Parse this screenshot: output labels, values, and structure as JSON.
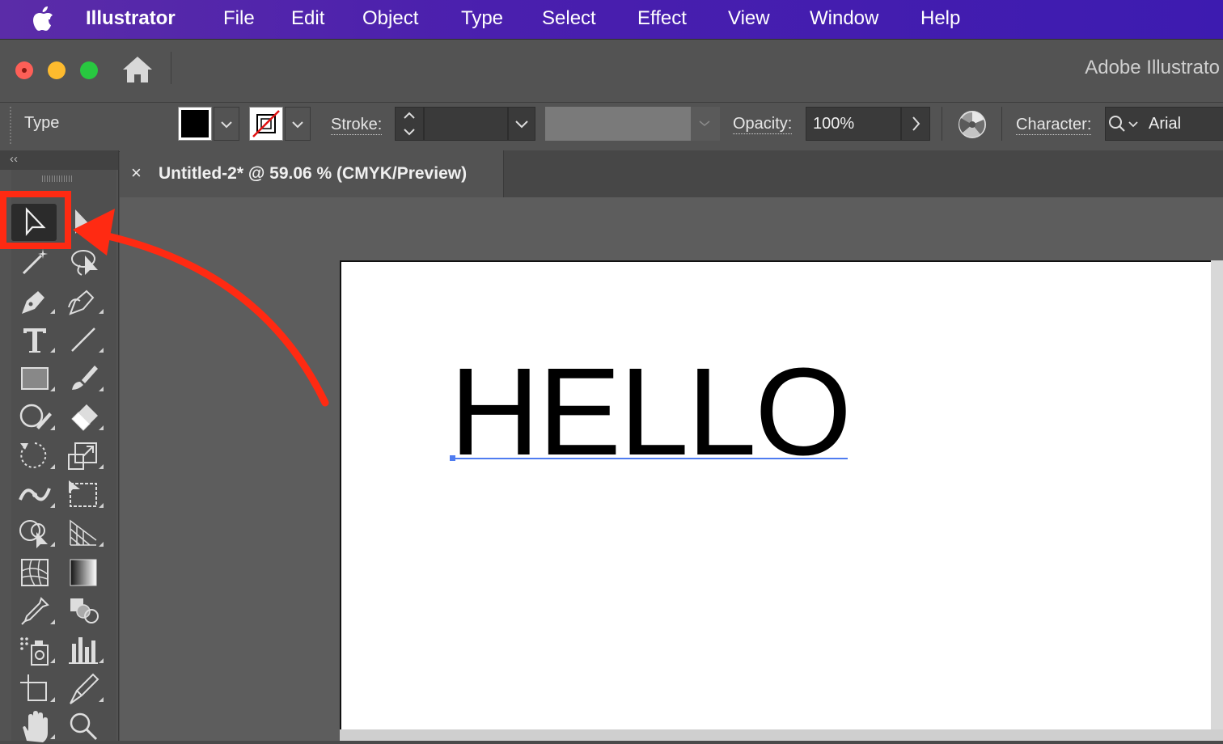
{
  "menubar": {
    "app_name": "Illustrator",
    "items": [
      "File",
      "Edit",
      "Object",
      "Type",
      "Select",
      "Effect",
      "View",
      "Window",
      "Help"
    ]
  },
  "window": {
    "title": "Adobe Illustrato"
  },
  "controlbar": {
    "mode_label": "Type",
    "stroke_label": "Stroke:",
    "opacity_label": "Opacity:",
    "opacity_value": "100%",
    "character_label": "Character:",
    "font_value": "Arial"
  },
  "document": {
    "tab_title": "Untitled-2* @ 59.06 % (CMYK/Preview)",
    "close_glyph": "×",
    "text_content": "HELLO"
  },
  "toolpanel": {
    "collapse_glyph": "‹‹"
  },
  "colors": {
    "menubar": "#4a1fae",
    "highlight": "#ff2a12",
    "selection": "#4f7cf0"
  }
}
